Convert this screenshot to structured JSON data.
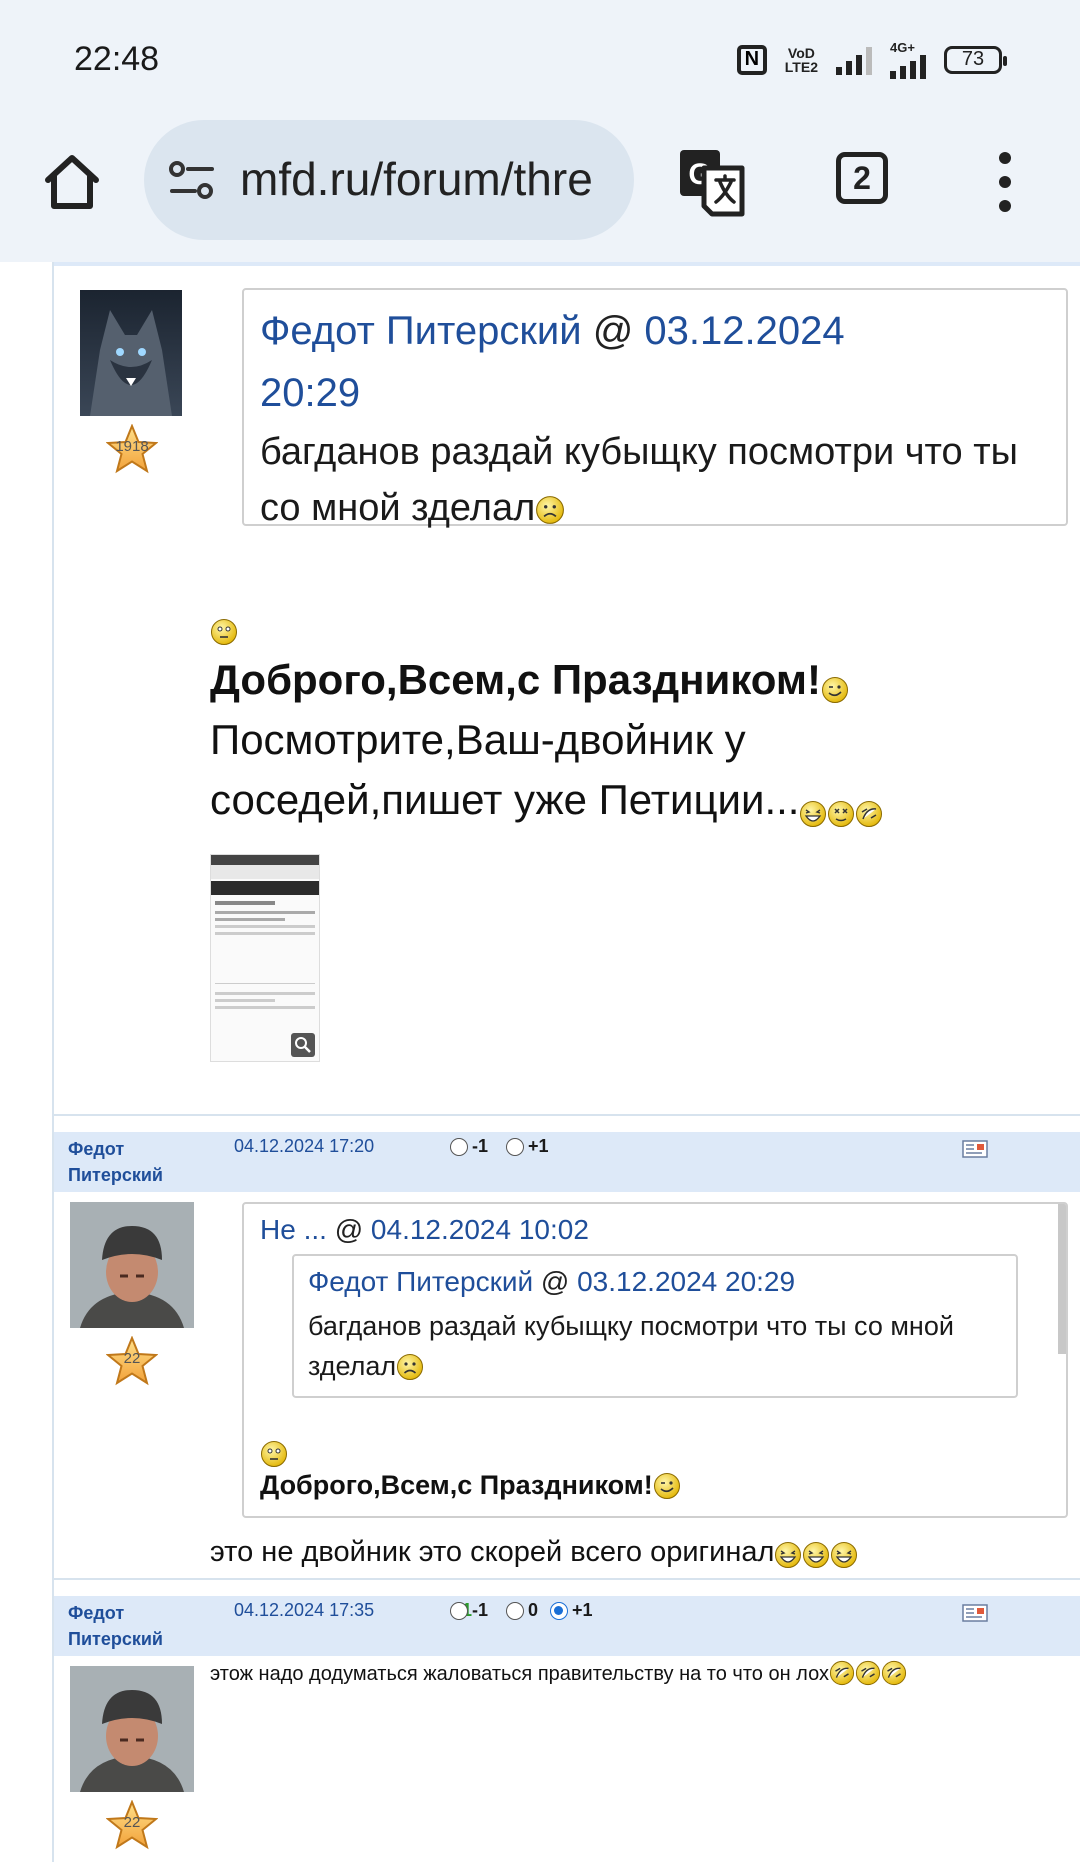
{
  "status_bar": {
    "time": "22:48",
    "nfc": "N",
    "volte_top": "VoD",
    "volte_bottom": "LTE2",
    "network": "4G+",
    "battery": "73"
  },
  "browser": {
    "url": "mfd.ru/forum/thre",
    "tab_count": "2"
  },
  "posts": [
    {
      "rank": "1918",
      "quote": {
        "author": "Федот Питерский",
        "at": "@",
        "date": "03.12.2024",
        "time": "20:29",
        "text": "багданов раздай кубыщку посмотри что ты со мной зделал"
      },
      "bold_text": "Доброго,Всем,с Праздником!",
      "text_line1": "Посмотрите,Ваш-двойник у",
      "text_line2": "соседей,пишет уже Петиции..."
    },
    {
      "author_line1": "Федот",
      "author_line2": "Питерский",
      "date": "04.12.2024 17:20",
      "vote_minus": "-1",
      "vote_plus": "+1",
      "rank": "22",
      "quote": {
        "author": "Не ...",
        "at": "@",
        "date": "04.12.2024 10:02",
        "inner": {
          "author": "Федот Питерский",
          "at": "@",
          "date": "03.12.2024 20:29",
          "text": "багданов раздай кубыщку посмотри что ты со мной зделал"
        },
        "bold_text": "Доброго,Всем,с Праздником!"
      },
      "text": "это не двойник это скорей всего оригинал"
    },
    {
      "author_line1": "Федот",
      "author_line2": "Питерский",
      "date": "04.12.2024 17:35",
      "score": "1",
      "vote_minus": "-1",
      "vote_zero": "0",
      "vote_plus": "+1",
      "rank": "22",
      "text": "этож надо додуматься жаловаться правительству на то что он лох"
    }
  ],
  "colors": {
    "link": "#1f4e9a",
    "header_bg": "#dde9f8",
    "score": "#2a9b2a",
    "chrome_bg": "#eef3f9"
  }
}
